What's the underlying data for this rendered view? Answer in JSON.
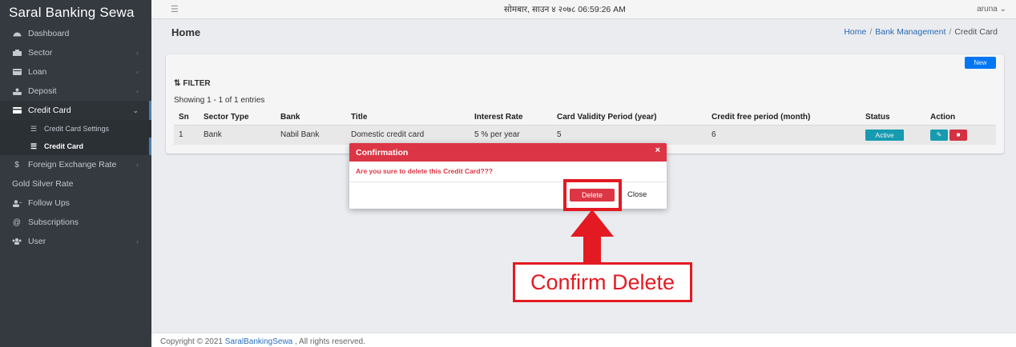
{
  "app": {
    "brand": "Saral Banking Sewa"
  },
  "sidebar": {
    "items": [
      {
        "label": "Dashboard",
        "icon": "dashboard-icon"
      },
      {
        "label": "Sector",
        "icon": "sector-icon",
        "expandable": true
      },
      {
        "label": "Loan",
        "icon": "loan-icon",
        "expandable": true
      },
      {
        "label": "Deposit",
        "icon": "deposit-icon",
        "expandable": true
      },
      {
        "label": "Credit Card",
        "icon": "credit-card-icon",
        "expandable": true,
        "active": true,
        "children": [
          {
            "label": "Credit Card Settings",
            "icon": "list-icon"
          },
          {
            "label": "Credit Card",
            "icon": "list-icon",
            "active": true
          }
        ]
      },
      {
        "label": "Foreign Exchange Rate",
        "icon": "dollar-icon",
        "expandable": true
      },
      {
        "label": "Gold Silver Rate"
      },
      {
        "label": "Follow Ups",
        "icon": "user-plus-icon"
      },
      {
        "label": "Subscriptions",
        "icon": "at-icon"
      },
      {
        "label": "User",
        "icon": "users-icon",
        "expandable": true
      }
    ]
  },
  "topbar": {
    "datetime": "सोमबार, साउन ४ २०७८ 06:59:26 AM",
    "user": "aruna"
  },
  "header": {
    "title": "Home",
    "breadcrumb": [
      "Home",
      "Bank Management",
      "Credit Card"
    ]
  },
  "card": {
    "new_label": "New",
    "filter_label": "FILTER",
    "showing": "Showing 1 - 1 of 1 entries",
    "columns": [
      "Sn",
      "Sector Type",
      "Bank",
      "Title",
      "Interest Rate",
      "Card Validity Period (year)",
      "Credit free period (month)",
      "Status",
      "Action"
    ],
    "rows": [
      {
        "sn": "1",
        "sector": "Bank",
        "bank": "Nabil Bank",
        "title": "Domestic credit card",
        "rate": "5 % per year",
        "validity": "5",
        "free": "6",
        "status": "Active"
      }
    ]
  },
  "modal": {
    "title": "Confirmation",
    "close_glyph": "×",
    "message": "Are you sure to delete this Credit Card???",
    "delete_label": "Delete",
    "close_label": "Close"
  },
  "annotation": {
    "callout": "Confirm Delete",
    "color": "#e31a22"
  },
  "footer": {
    "prefix": "Copyright © 2021 ",
    "link": "SaralBankingSewa",
    "suffix": " , All rights reserved."
  },
  "colors": {
    "sidebar": "#343a40",
    "danger": "#dc3545",
    "info": "#17a2b8",
    "primary": "#007bff"
  }
}
